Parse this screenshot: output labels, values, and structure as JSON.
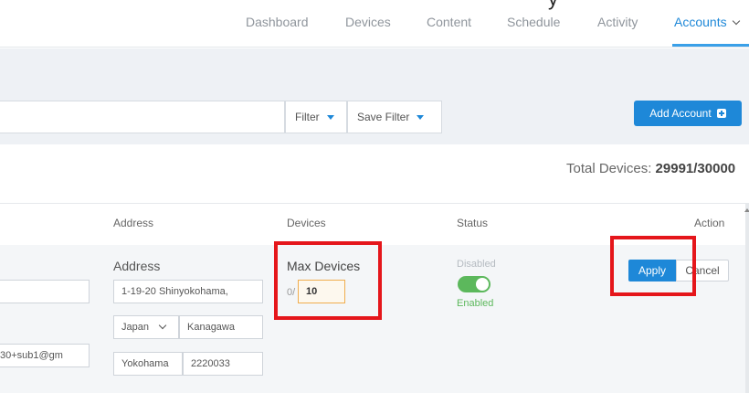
{
  "caption": "y",
  "nav": {
    "items": [
      "Dashboard",
      "Devices",
      "Content",
      "Schedule",
      "Activity"
    ],
    "active": "Accounts",
    "active_chevron": "chevron-down-icon"
  },
  "toolbar": {
    "search_value": "",
    "filter_label": "Filter",
    "save_filter_label": "Save Filter",
    "add_account_label": "Add Account"
  },
  "total": {
    "label": "Total Devices:",
    "value": "29991/30000"
  },
  "table": {
    "headers": {
      "address": "Address",
      "devices": "Devices",
      "status": "Status",
      "action": "Action"
    }
  },
  "row": {
    "name_value": "",
    "email_value": "30+sub1@gm",
    "address_label": "Address",
    "address_line": "1-19-20 Shinyokohama,",
    "country": "Japan",
    "state": "Kanagawa",
    "city": "Yokohama",
    "postal": "2220033",
    "max_devices_label": "Max Devices",
    "device_prefix": "0/",
    "max_devices_value": "10",
    "status_disabled": "Disabled",
    "status_enabled": "Enabled",
    "toggle_on": true,
    "apply_label": "Apply",
    "cancel_label": "Cancel"
  },
  "colors": {
    "accent": "#1e88d8",
    "toggle": "#5cb85c",
    "highlight": "#e5161b"
  }
}
